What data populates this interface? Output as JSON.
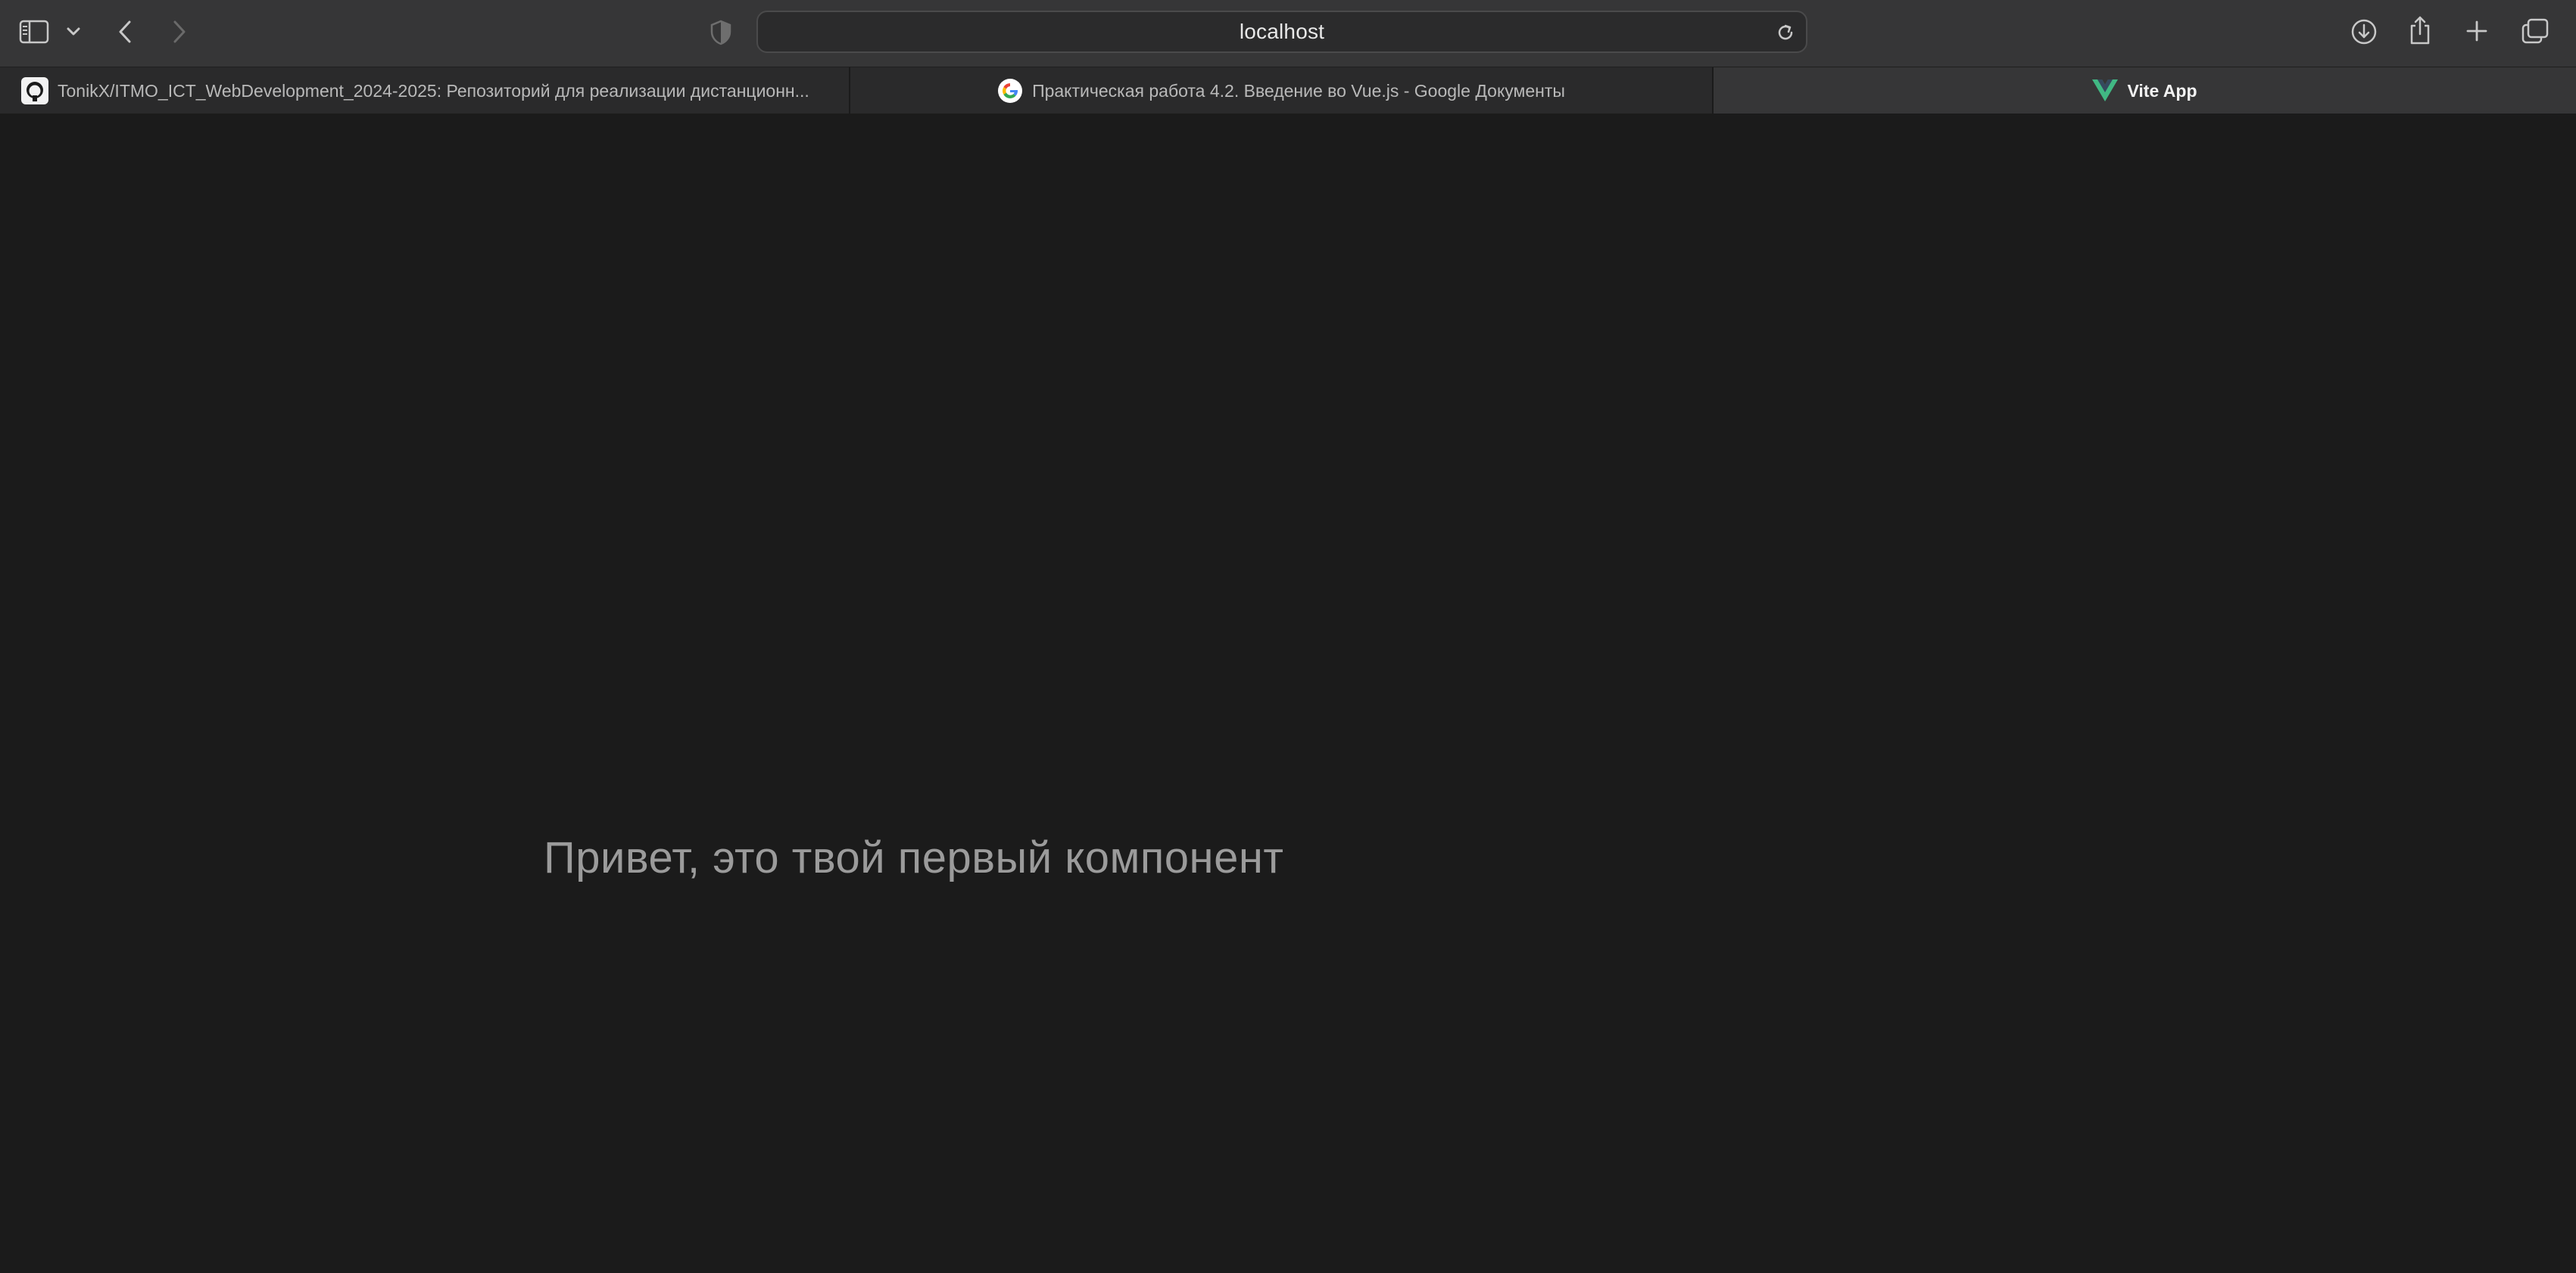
{
  "browser": {
    "address": "localhost",
    "tabs": [
      {
        "title": "TonikX/ITMO_ICT_WebDevelopment_2024-2025: Репозиторий для реализации дистанционн...",
        "favicon": "github-icon",
        "active": false
      },
      {
        "title": "Практическая работа 4.2. Введение во Vue.js - Google Документы",
        "favicon": "google-icon",
        "active": false
      },
      {
        "title": "Vite App",
        "favicon": "vue-icon",
        "active": true
      }
    ]
  },
  "page": {
    "message": "Привет, это твой первый компонент"
  },
  "colors": {
    "toolbar": "#363637",
    "page_background": "#1b1b1b",
    "message_text": "#9b9b9b",
    "vue_green": "#41b883"
  }
}
